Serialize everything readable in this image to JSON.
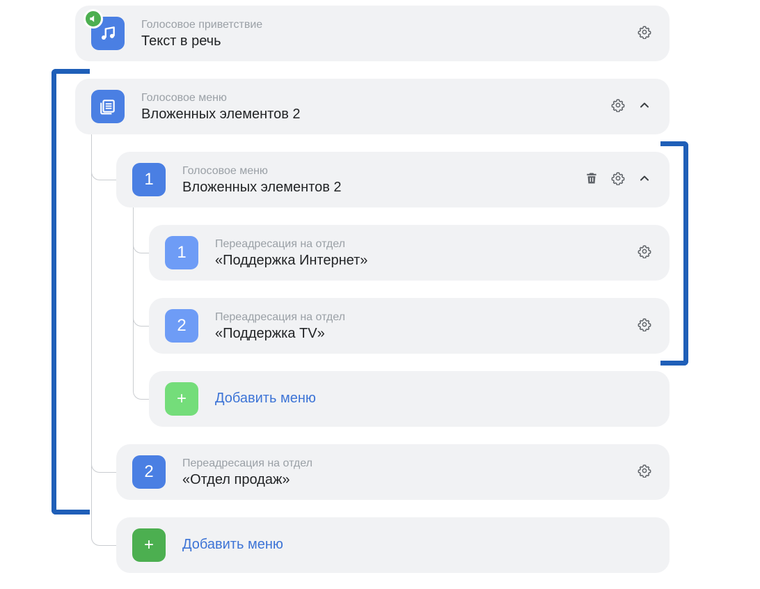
{
  "colors": {
    "card_bg": "#f1f2f4",
    "tile_dark": "#4a7fe3",
    "tile_light": "#6e9cf6",
    "add_green_dark": "#4caf50",
    "add_green_light": "#74dd7a",
    "link": "#3d74d6",
    "bracket": "#1f5fb8"
  },
  "greeting": {
    "subtitle": "Голосовое приветствие",
    "title": "Текст в речь",
    "icon": "music-note-icon",
    "badge_icon": "speaker-icon"
  },
  "menu_root": {
    "subtitle": "Голосовое меню",
    "title": "Вложенных элементов 2",
    "icon": "list-icon"
  },
  "submenu": {
    "number": "1",
    "subtitle": "Голосовое меню",
    "title": "Вложенных элементов 2",
    "items": [
      {
        "number": "1",
        "subtitle": "Переадресация на отдел",
        "title": "«Поддержка Интернет»"
      },
      {
        "number": "2",
        "subtitle": "Переадресация на отдел",
        "title": "«Поддержка TV»"
      }
    ],
    "add": {
      "symbol": "+",
      "label": "Добавить меню"
    }
  },
  "root_item_2": {
    "number": "2",
    "subtitle": "Переадресация на отдел",
    "title": "«Отдел продаж»"
  },
  "root_add": {
    "symbol": "+",
    "label": "Добавить меню"
  }
}
